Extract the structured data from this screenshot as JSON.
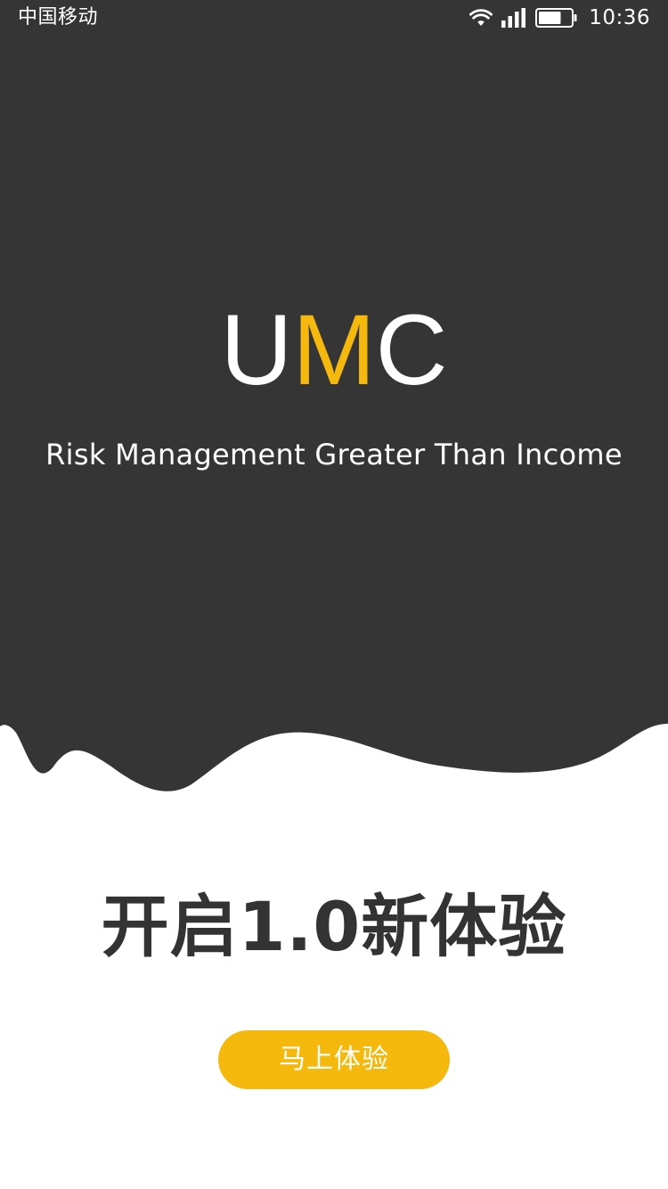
{
  "status_bar": {
    "carrier": "中国移动",
    "time": "10:36",
    "icons": [
      "wifi-icon",
      "signal-icon",
      "battery-icon"
    ],
    "battery_level": 0.7
  },
  "brand": {
    "letters": [
      "U",
      "M",
      "C"
    ],
    "accent_letter_index": 1,
    "tagline": "Risk Management Greater Than Income"
  },
  "main": {
    "headline": "开启1.0新体验",
    "cta_label": "马上体验"
  },
  "colors": {
    "hero_background": "#353535",
    "accent": "#f5b90e",
    "page_background": "#ffffff",
    "headline_text": "#333333",
    "light_text": "#ffffff"
  }
}
